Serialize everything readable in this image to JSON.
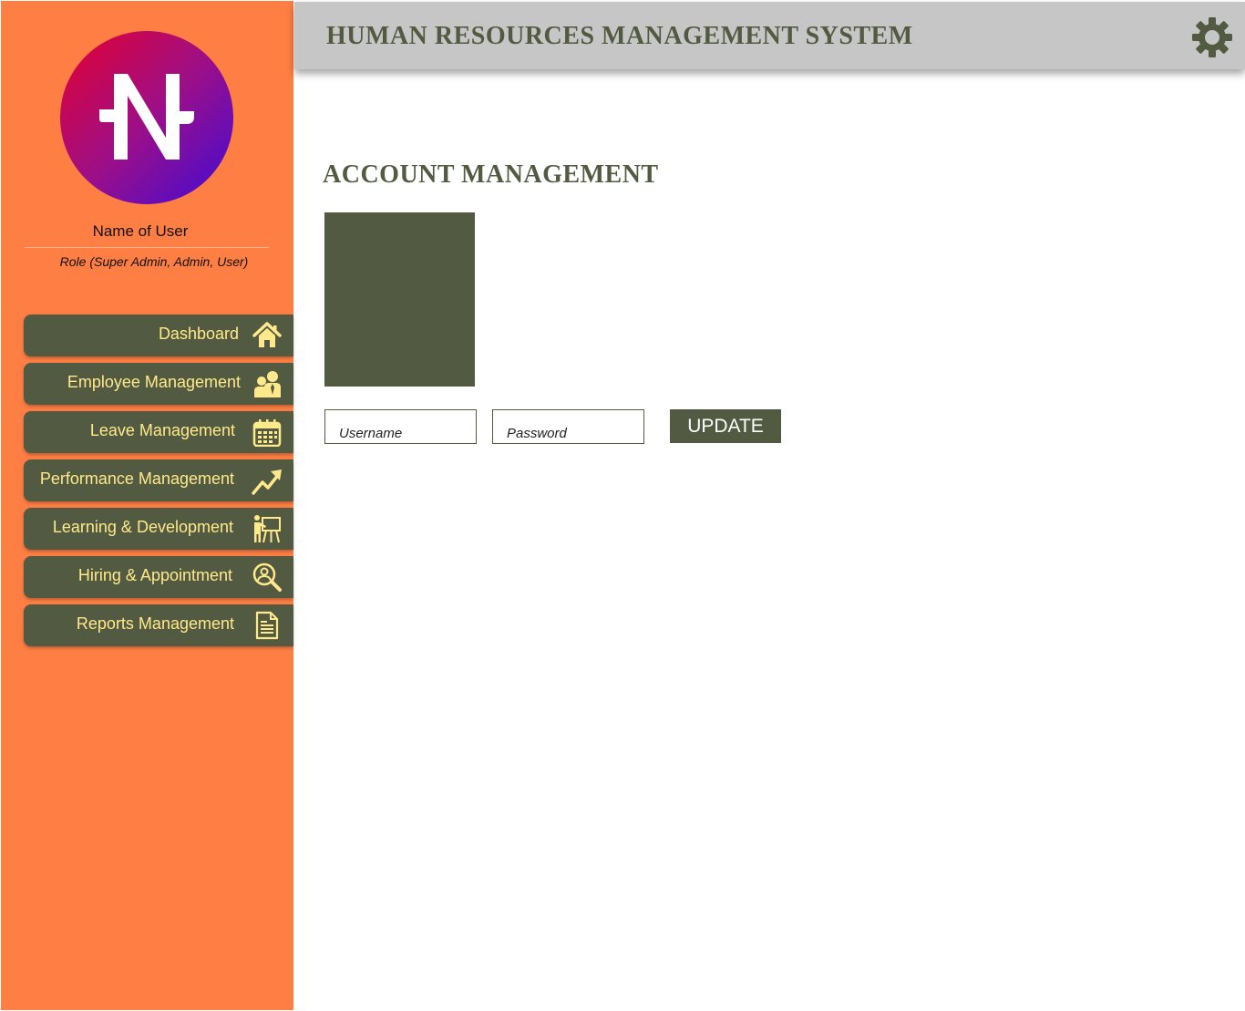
{
  "app": {
    "title": "HUMAN RESOURCES MANAGEMENT SYSTEM",
    "settings_icon": "gear-icon"
  },
  "colors": {
    "sidebar": "#fe7e44",
    "accent": "#525b41",
    "nav_text": "#ffe98a",
    "header": "#c6c6c6",
    "logo_gradient": [
      "#e5002f",
      "#3f0bd8"
    ]
  },
  "user": {
    "name": "Name of User",
    "role": "Role (Super Admin, Admin, User)"
  },
  "nav": {
    "items": [
      {
        "label": "Dashboard",
        "icon": "home-icon"
      },
      {
        "label": "Employee Management",
        "icon": "employees-icon"
      },
      {
        "label": "Leave Management",
        "icon": "calendar-icon"
      },
      {
        "label": "Performance Management",
        "icon": "trend-up-icon"
      },
      {
        "label": "Learning & Development",
        "icon": "presenter-icon"
      },
      {
        "label": "Hiring & Appointment",
        "icon": "search-person-icon"
      },
      {
        "label": "Reports Management",
        "icon": "document-icon"
      }
    ]
  },
  "main": {
    "title": "ACCOUNT MANAGEMENT",
    "username_placeholder": "Username",
    "password_placeholder": "Password",
    "update_label": "UPDATE"
  }
}
